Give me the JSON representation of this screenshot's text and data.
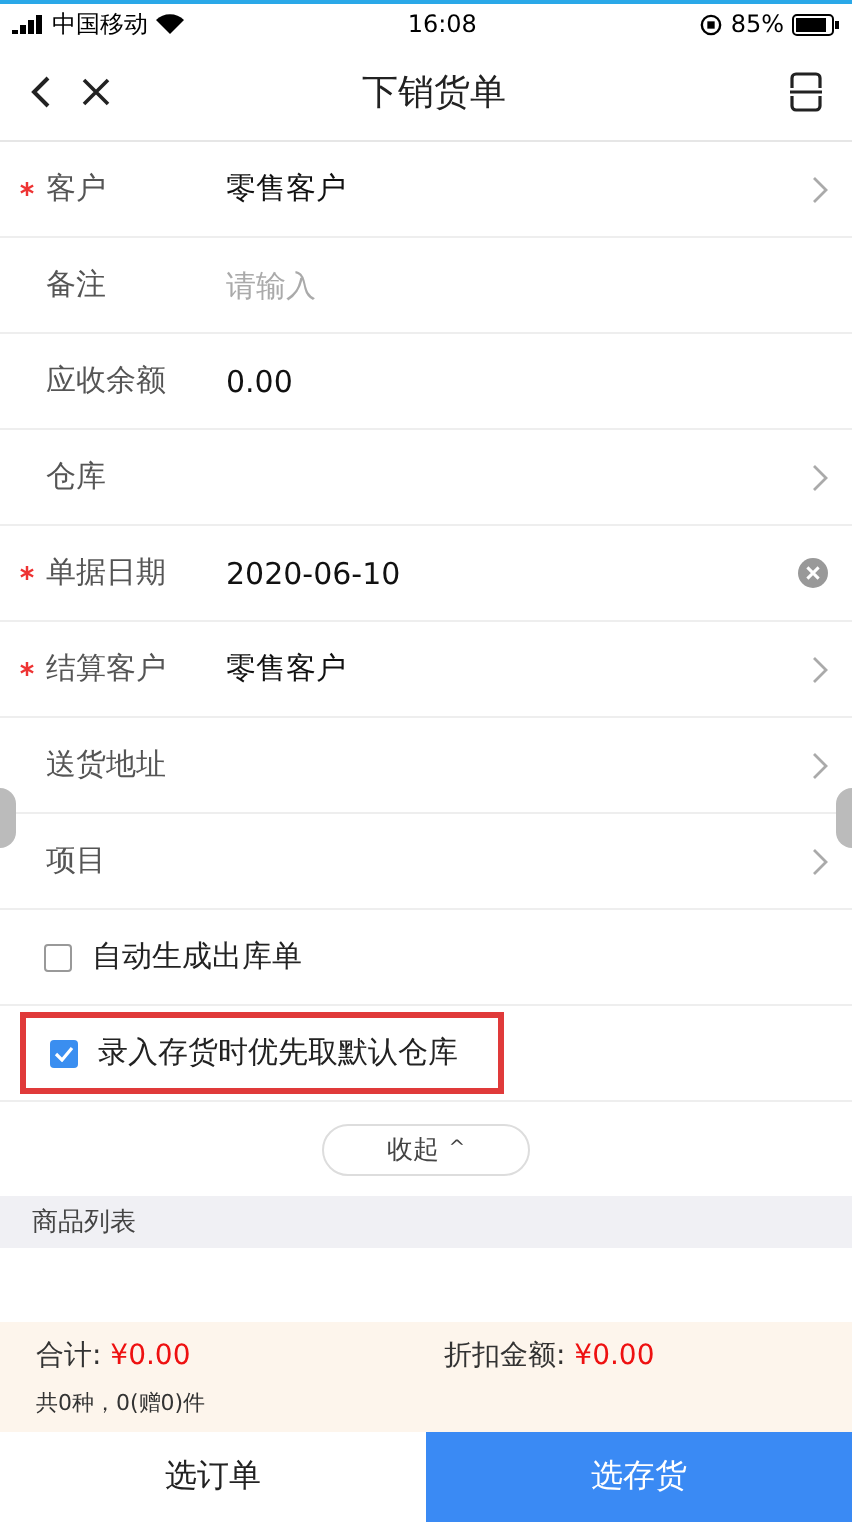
{
  "status_bar": {
    "carrier": "中国移动",
    "time": "16:08",
    "battery": "85%"
  },
  "nav": {
    "title": "下销货单"
  },
  "fields": [
    {
      "kind": "select",
      "label": "客户",
      "required": true,
      "value": "零售客户"
    },
    {
      "kind": "input",
      "label": "备注",
      "required": false,
      "placeholder": "请输入"
    },
    {
      "kind": "text",
      "label": "应收余额",
      "required": false,
      "value": "0.00"
    },
    {
      "kind": "select",
      "label": "仓库",
      "required": false
    },
    {
      "kind": "date",
      "label": "单据日期",
      "required": true,
      "value": "2020-06-10"
    },
    {
      "kind": "select",
      "label": "结算客户",
      "required": true,
      "value": "零售客户"
    },
    {
      "kind": "select",
      "label": "送货地址",
      "required": false
    },
    {
      "kind": "select",
      "label": "项目",
      "required": false
    }
  ],
  "options": [
    {
      "label": "自动生成出库单",
      "checked": false,
      "highlighted": false
    },
    {
      "label": "录入存货时优先取默认仓库",
      "checked": true,
      "highlighted": true
    }
  ],
  "collapse_button": {
    "label": "收起",
    "caret": "^"
  },
  "section": {
    "title": "商品列表"
  },
  "summary": {
    "total_label": "合计:",
    "total": "¥0.00",
    "discount_label": "折扣金额:",
    "discount": "¥0.00",
    "count": "共0种，0(赠0)件"
  },
  "actions": [
    {
      "label": "选订单",
      "primary": false
    },
    {
      "label": "选存货",
      "primary": true
    }
  ]
}
